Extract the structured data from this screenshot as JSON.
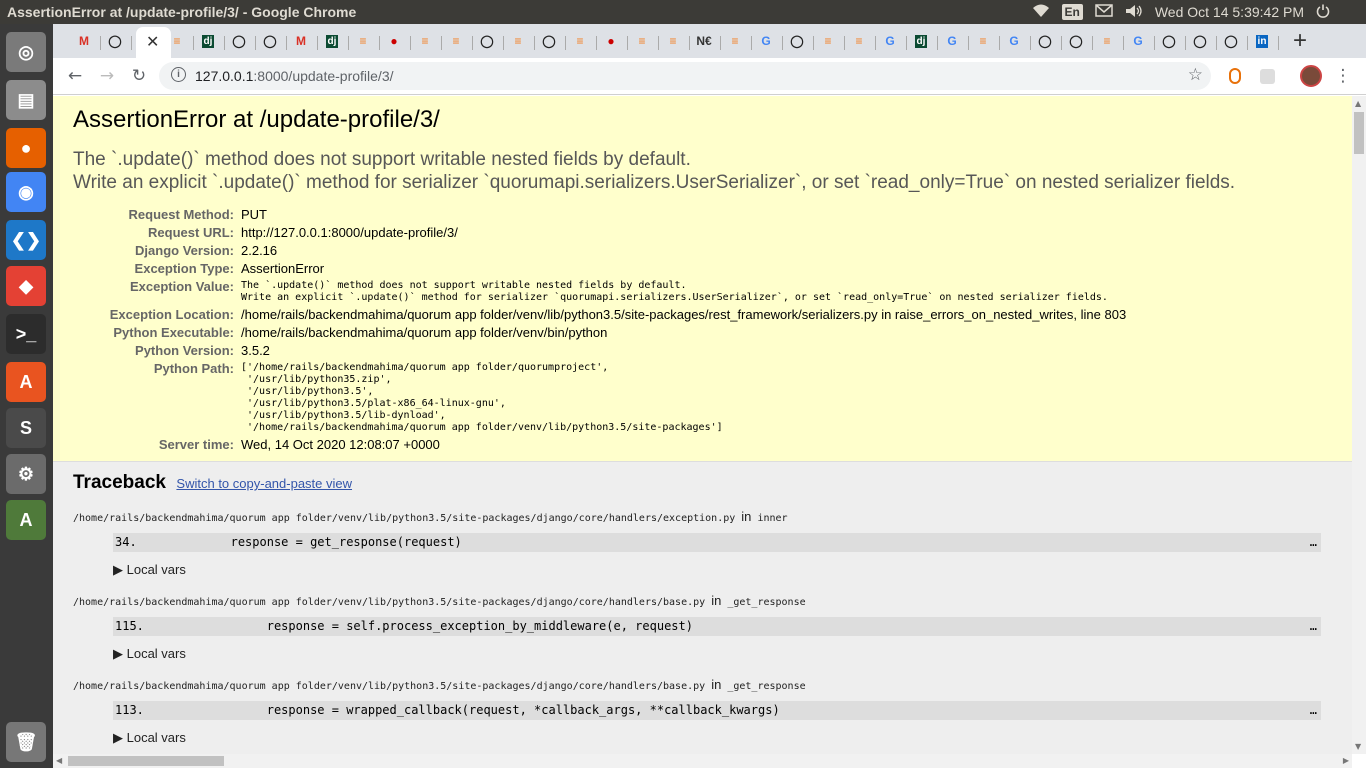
{
  "system_bar": {
    "window_title": "AssertionError at /update-profile/3/ - Google Chrome",
    "keyboard_layout": "En",
    "datetime": "Wed Oct 14  5:39:42 PM",
    "icons": [
      "wifi-icon",
      "mail-icon",
      "volume-icon",
      "power-icon"
    ]
  },
  "launcher": {
    "apps": [
      {
        "name": "ubuntu-home",
        "color": "#7a7a7a",
        "glyph": "◎"
      },
      {
        "name": "files",
        "color": "#8c8c8c",
        "glyph": "▤"
      },
      {
        "name": "firefox",
        "color": "#e66000",
        "glyph": "●"
      },
      {
        "name": "chrome",
        "color": "#4285f4",
        "glyph": "◉"
      },
      {
        "name": "vscode",
        "color": "#1e78c8",
        "glyph": "❮❯"
      },
      {
        "name": "anydesk",
        "color": "#e44134",
        "glyph": "◆"
      },
      {
        "name": "terminal",
        "color": "#2c2c2c",
        "glyph": ">_"
      },
      {
        "name": "software-center",
        "color": "#e95420",
        "glyph": "A"
      },
      {
        "name": "sublime-text",
        "color": "#4a4a4a",
        "glyph": "S"
      },
      {
        "name": "system-settings",
        "color": "#6b6b6b",
        "glyph": "⚙"
      },
      {
        "name": "software-updater",
        "color": "#4f7a3a",
        "glyph": "A"
      },
      {
        "name": "trash",
        "color": "#777",
        "glyph": "🗑"
      }
    ]
  },
  "tabs": {
    "items": [
      "M",
      "gh",
      "x",
      "so",
      "dj",
      "gh",
      "gh",
      "M",
      "dj",
      "so",
      "•",
      "so",
      "so",
      "gh",
      "so",
      "gh",
      "so",
      "•",
      "so",
      "so",
      "N€",
      "so",
      "G",
      "gh",
      "so",
      "so",
      "G",
      "dj",
      "G",
      "so",
      "G",
      "gh",
      "gh",
      "so",
      "G",
      "gh",
      "gh",
      "gh",
      "in"
    ],
    "new_tab_label": "+"
  },
  "address_bar": {
    "host": "127.0.0.1",
    "rest": ":8000/update-profile/3/"
  },
  "error_page": {
    "title": "AssertionError at /update-profile/3/",
    "message_line1": "The `.update()` method does not support writable nested fields by default.",
    "message_line2": "Write an explicit `.update()` method for serializer `quorumapi.serializers.UserSerializer`, or set `read_only=True` on nested serializer fields.",
    "meta": [
      {
        "label": "Request Method:",
        "value": "PUT",
        "mono": false
      },
      {
        "label": "Request URL:",
        "value": "http://127.0.0.1:8000/update-profile/3/",
        "mono": false
      },
      {
        "label": "Django Version:",
        "value": "2.2.16",
        "mono": false
      },
      {
        "label": "Exception Type:",
        "value": "AssertionError",
        "mono": false
      },
      {
        "label": "Exception Value:",
        "value": "The `.update()` method does not support writable nested fields by default.\nWrite an explicit `.update()` method for serializer `quorumapi.serializers.UserSerializer`, or set `read_only=True` on nested serializer fields.",
        "mono": true
      },
      {
        "label": "Exception Location:",
        "value": "/home/rails/backendmahima/quorum app folder/venv/lib/python3.5/site-packages/rest_framework/serializers.py in raise_errors_on_nested_writes, line 803",
        "mono": false
      },
      {
        "label": "Python Executable:",
        "value": "/home/rails/backendmahima/quorum app folder/venv/bin/python",
        "mono": false
      },
      {
        "label": "Python Version:",
        "value": "3.5.2",
        "mono": false
      },
      {
        "label": "Python Path:",
        "value": "['/home/rails/backendmahima/quorum app folder/quorumproject',\n '/usr/lib/python35.zip',\n '/usr/lib/python3.5',\n '/usr/lib/python3.5/plat-x86_64-linux-gnu',\n '/usr/lib/python3.5/lib-dynload',\n '/home/rails/backendmahima/quorum app folder/venv/lib/python3.5/site-packages']",
        "mono": true
      },
      {
        "label": "Server time:",
        "value": "Wed, 14 Oct 2020 12:08:07 +0000",
        "mono": false
      }
    ]
  },
  "traceback": {
    "heading": "Traceback",
    "switch_link": "Switch to copy-and-paste view",
    "frames": [
      {
        "file": "/home/rails/backendmahima/quorum app folder/venv/lib/python3.5/site-packages/django/core/handlers/exception.py",
        "in_label": "in",
        "func": "inner",
        "line": "34.             response = get_response(request)",
        "ellipsis": "…",
        "local_vars": "▶ Local vars"
      },
      {
        "file": "/home/rails/backendmahima/quorum app folder/venv/lib/python3.5/site-packages/django/core/handlers/base.py",
        "in_label": "in",
        "func": "_get_response",
        "line": "115.                 response = self.process_exception_by_middleware(e, request)",
        "ellipsis": "…",
        "local_vars": "▶ Local vars"
      },
      {
        "file": "/home/rails/backendmahima/quorum app folder/venv/lib/python3.5/site-packages/django/core/handlers/base.py",
        "in_label": "in",
        "func": "_get_response",
        "line": "113.                 response = wrapped_callback(request, *callback_args, **callback_kwargs)",
        "ellipsis": "…",
        "local_vars": "▶ Local vars"
      }
    ]
  }
}
